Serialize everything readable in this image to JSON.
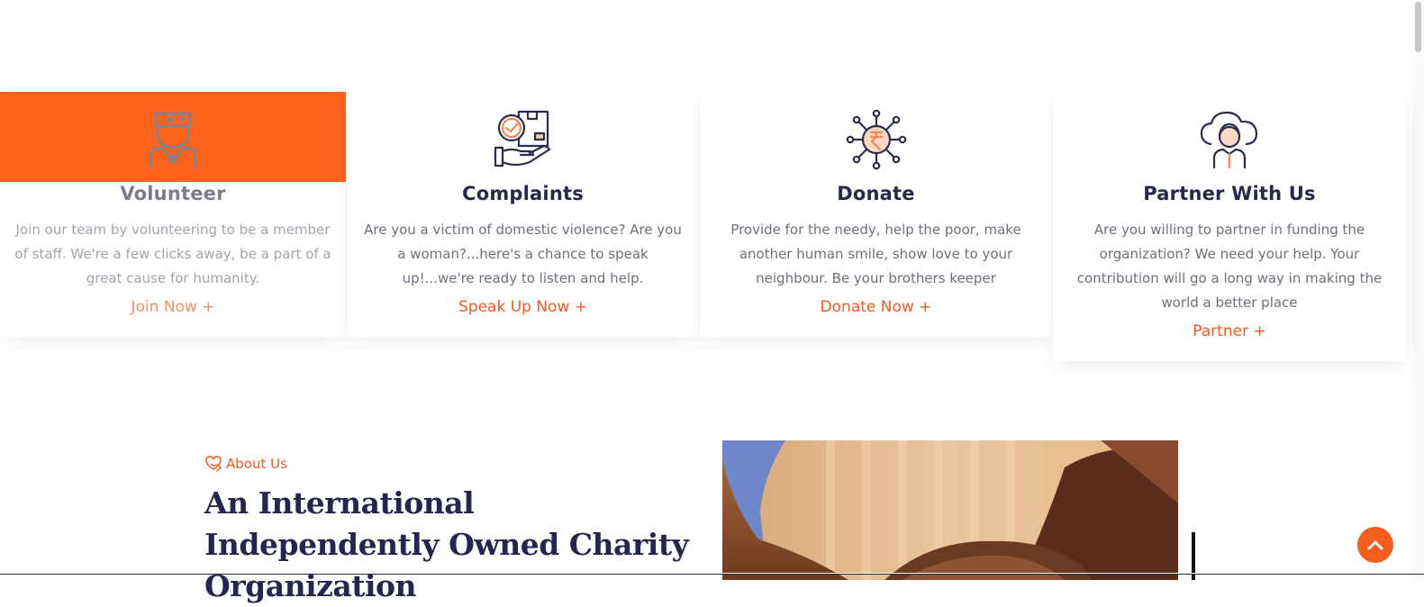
{
  "colors": {
    "accent": "#ff621d",
    "heading": "#262a4a",
    "text": "#6e6f7d"
  },
  "cards": [
    {
      "icon": "volunteer-icon",
      "title": "Volunteer",
      "desc": "Join our team by volunteering to be a member of staff. We're a few clicks away, be a part of a great cause for humanity.",
      "cta": "Join Now +"
    },
    {
      "icon": "complaint-box-hand-icon",
      "title": "Complaints",
      "desc": "Are you a victim of domestic violence? Are you a woman?...here's a chance to speak up!...we're ready to listen and help.",
      "cta": "Speak Up Now +"
    },
    {
      "icon": "rupee-network-icon",
      "title": "Donate",
      "desc": "Provide for the needy, help the poor, make another human smile, show love to your neighbour. Be your brothers keeper",
      "cta": "Donate Now +"
    },
    {
      "icon": "cloud-person-icon",
      "title": "Partner With Us",
      "desc": "Are you willing to partner in funding the organization? We need your help. Your contribution will go a long way in making the world a better place",
      "cta": "Partner +"
    }
  ],
  "about": {
    "tag": "About Us",
    "title": "An International Independently Owned Charity Organization"
  },
  "icons": {
    "scroll_top": "chevron-up-icon",
    "about_tag": "heart-hand-icon"
  }
}
